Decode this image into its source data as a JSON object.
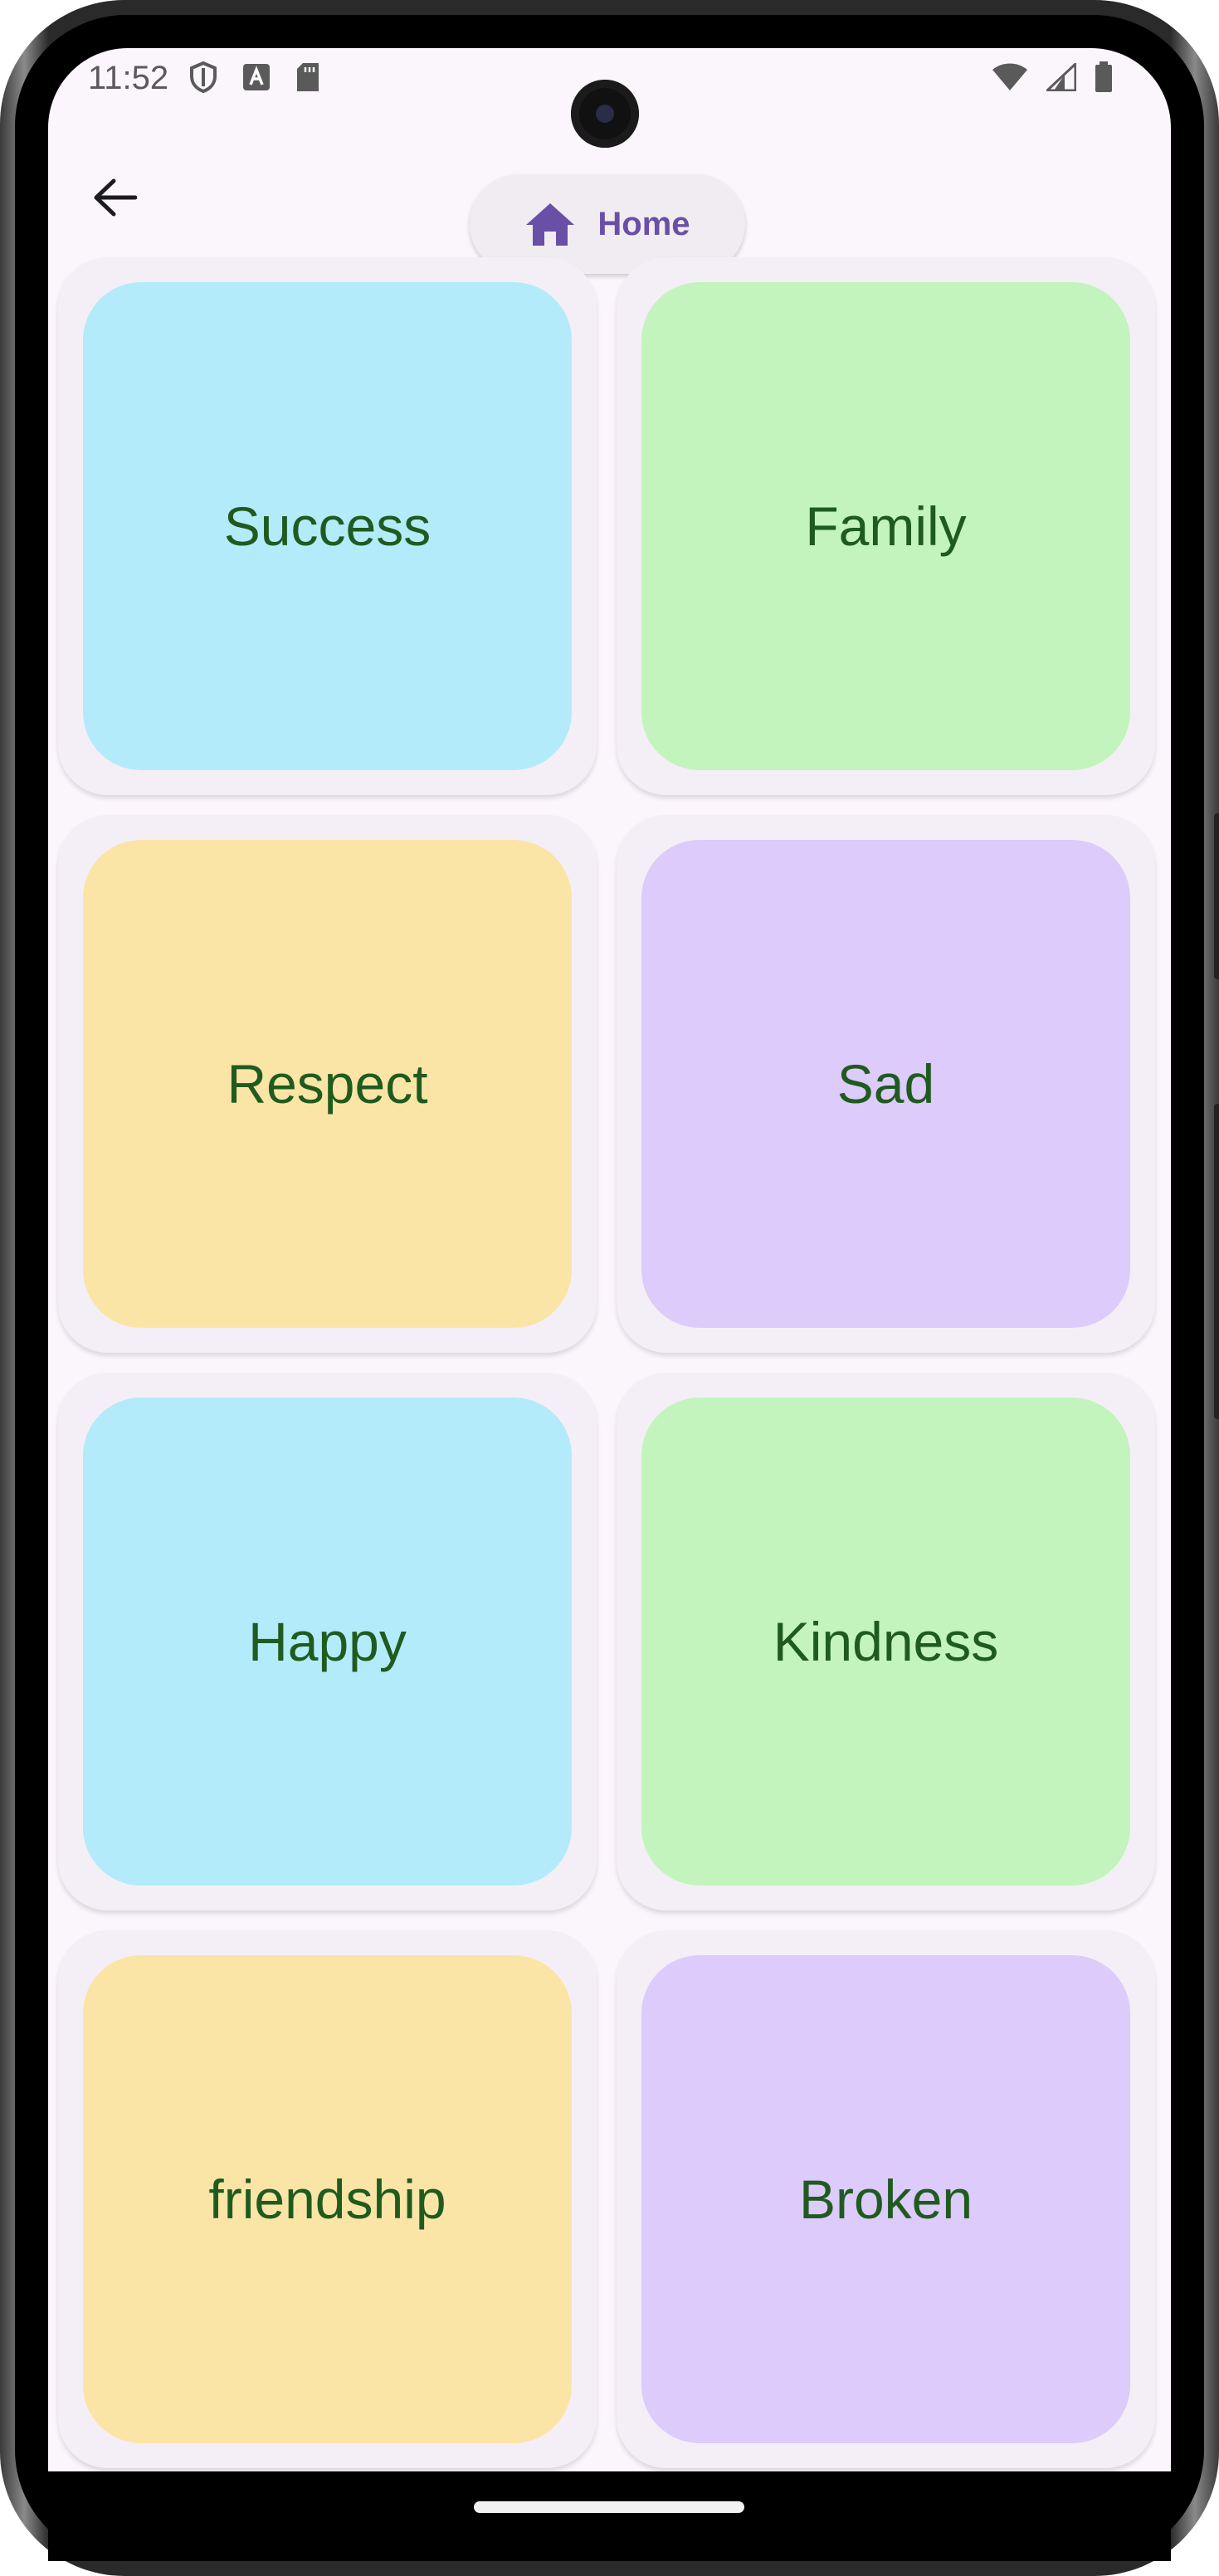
{
  "status_bar": {
    "time": "11:52",
    "left_icons": [
      "shield-icon",
      "text-a-icon",
      "sd-card-icon"
    ],
    "right_icons": [
      "wifi-icon",
      "signal-icon",
      "battery-icon"
    ]
  },
  "app_bar": {
    "back_icon": "arrow-left-icon",
    "home_button": {
      "label": "Home",
      "icon": "home-icon",
      "color": "#6a4fa6"
    }
  },
  "cards": [
    {
      "label": "Success",
      "color": "#b3ebfb"
    },
    {
      "label": "Family",
      "color": "#c3f4bd"
    },
    {
      "label": "Respect",
      "color": "#fbe5a6"
    },
    {
      "label": "Sad",
      "color": "#dccbfb"
    },
    {
      "label": "Happy",
      "color": "#b3ebfb"
    },
    {
      "label": "Kindness",
      "color": "#c3f4bd"
    },
    {
      "label": "friendship",
      "color": "#fbe5a6"
    },
    {
      "label": "Broken",
      "color": "#dccbfb"
    }
  ],
  "colors": {
    "background": "#fbf6fc",
    "label_text": "#1f5b1f"
  }
}
